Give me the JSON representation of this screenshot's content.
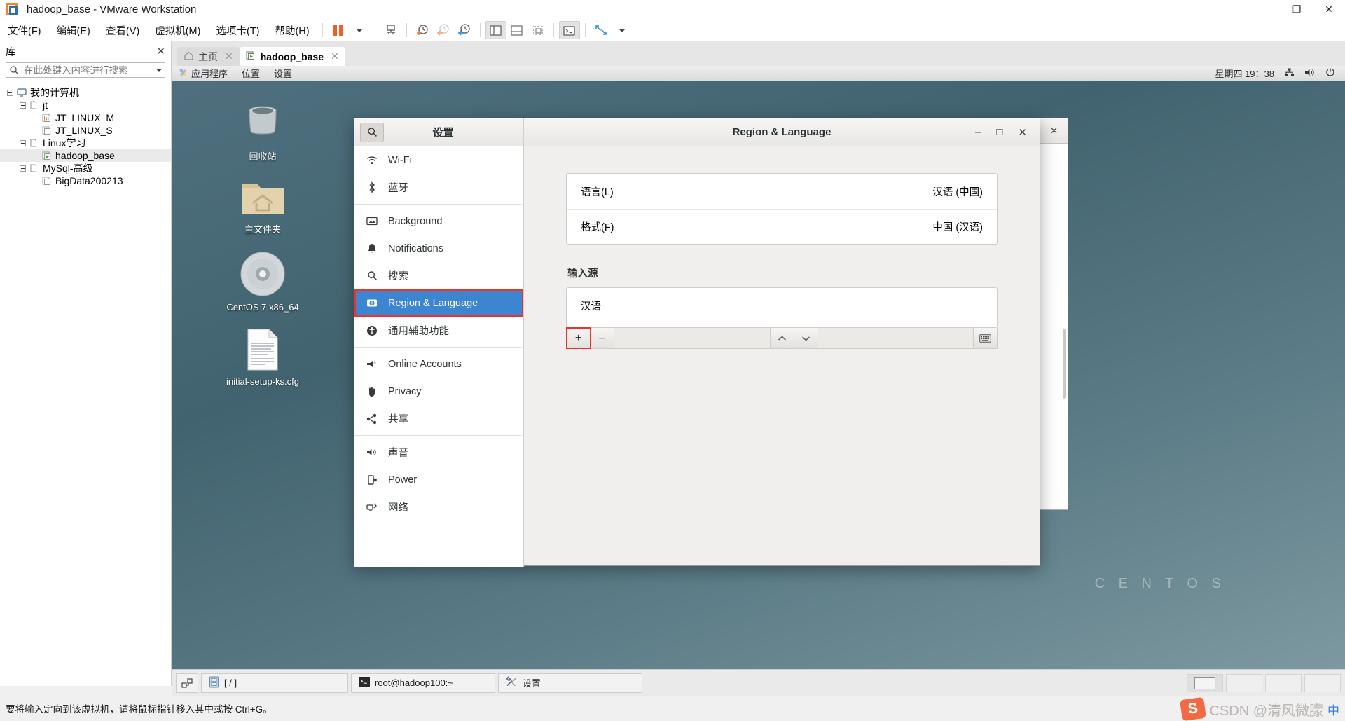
{
  "window": {
    "title": "hadoop_base - VMware Workstation",
    "minimize": "—",
    "maximize": "❐",
    "close": "✕"
  },
  "menubar": {
    "items": [
      {
        "label": "文件(F)",
        "key": "F"
      },
      {
        "label": "编辑(E)",
        "key": "E"
      },
      {
        "label": "查看(V)",
        "key": "V"
      },
      {
        "label": "虚拟机(M)",
        "key": "M"
      },
      {
        "label": "选项卡(T)",
        "key": "T"
      },
      {
        "label": "帮助(H)",
        "key": "H"
      }
    ],
    "icons": [
      "pause-icon",
      "dropdown-caret-icon",
      "send-ctrl-alt-del-icon",
      "snapshot-take-icon",
      "snapshot-revert-icon",
      "snapshot-manager-icon",
      "show-library-icon",
      "show-thumbnails-icon",
      "console-view-icon",
      "terminal-icon",
      "fullscreen-icon",
      "unity-caret-icon"
    ]
  },
  "library": {
    "title": "库",
    "close_label": "✕",
    "search_placeholder": "在此处键入内容进行搜索",
    "search_value": "",
    "tree": [
      {
        "label": "我的计算机",
        "depth": 0,
        "icon": "computer-icon",
        "expander": "minus",
        "selected": false
      },
      {
        "label": "jt",
        "depth": 1,
        "icon": "folder-icon",
        "expander": "minus",
        "selected": false
      },
      {
        "label": "JT_LINUX_M",
        "depth": 2,
        "icon": "vm-suspended-icon",
        "expander": "none",
        "selected": false
      },
      {
        "label": "JT_LINUX_S",
        "depth": 2,
        "icon": "vm-off-icon",
        "expander": "none",
        "selected": false
      },
      {
        "label": "Linux学习",
        "depth": 1,
        "icon": "folder-icon",
        "expander": "minus",
        "selected": false
      },
      {
        "label": "hadoop_base",
        "depth": 2,
        "icon": "vm-running-icon",
        "expander": "none",
        "selected": true
      },
      {
        "label": "MySql-高级",
        "depth": 1,
        "icon": "folder-icon",
        "expander": "minus",
        "selected": false
      },
      {
        "label": "BigData200213",
        "depth": 2,
        "icon": "vm-off-icon",
        "expander": "none",
        "selected": false
      }
    ]
  },
  "tabs": [
    {
      "label": "主页",
      "icon": "home-icon",
      "active": false,
      "close": "✕"
    },
    {
      "label": "hadoop_base",
      "icon": "vm-running-icon",
      "active": true,
      "close": "✕"
    }
  ],
  "guest": {
    "panel": {
      "menus": [
        "应用程序",
        "位置",
        "设置"
      ],
      "activities_icon": "gnome-foot-icon",
      "clock": "星期四 19：38",
      "tray_icons": [
        "network-icon",
        "volume-icon",
        "power-icon"
      ]
    },
    "desktop_icons": [
      {
        "label": "回收站",
        "icon": "trash-icon"
      },
      {
        "label": "主文件夹",
        "icon": "home-folder-icon"
      },
      {
        "label": "CentOS 7 x86_64",
        "icon": "cd-icon"
      },
      {
        "label": "initial-setup-ks.cfg",
        "icon": "text-file-icon"
      }
    ],
    "watermark": "C E N T O S"
  },
  "settings": {
    "search_icon": "search-icon",
    "sidebar_title": "设置",
    "content_title": "Region & Language",
    "window_controls": {
      "minimize": "–",
      "maximize": "□",
      "close": "✕"
    },
    "sidebar": [
      {
        "label": "Wi-Fi",
        "icon": "wifi-icon",
        "selected": false,
        "sep_after": false
      },
      {
        "label": "蓝牙",
        "icon": "bluetooth-icon",
        "selected": false,
        "sep_after": true
      },
      {
        "label": "Background",
        "icon": "background-icon",
        "selected": false,
        "sep_after": false
      },
      {
        "label": "Notifications",
        "icon": "bell-icon",
        "selected": false,
        "sep_after": false
      },
      {
        "label": "搜索",
        "icon": "search-icon",
        "selected": false,
        "sep_after": false
      },
      {
        "label": "Region & Language",
        "icon": "region-language-icon",
        "selected": true,
        "sep_after": false
      },
      {
        "label": "通用辅助功能",
        "icon": "accessibility-icon",
        "selected": false,
        "sep_after": true
      },
      {
        "label": "Online Accounts",
        "icon": "online-accounts-icon",
        "selected": false,
        "sep_after": false
      },
      {
        "label": "Privacy",
        "icon": "privacy-hand-icon",
        "selected": false,
        "sep_after": false
      },
      {
        "label": "共享",
        "icon": "sharing-icon",
        "selected": false,
        "sep_after": true
      },
      {
        "label": "声音",
        "icon": "sound-icon",
        "selected": false,
        "sep_after": false
      },
      {
        "label": "Power",
        "icon": "power-battery-icon",
        "selected": false,
        "sep_after": false
      },
      {
        "label": "网络",
        "icon": "network-icon",
        "selected": false,
        "sep_after": false
      }
    ],
    "rows": [
      {
        "label": "语言(L)",
        "value": "汉语 (中国)"
      },
      {
        "label": "格式(F)",
        "value": "中国 (汉语)"
      }
    ],
    "input_sources": {
      "section_title": "输入源",
      "items": [
        "汉语"
      ],
      "buttons": {
        "add": "+",
        "remove": "–",
        "move_up": "⌃",
        "move_down": "⌄",
        "keyboard": "keyboard-icon"
      },
      "add_highlighted": true
    }
  },
  "bottombar": {
    "buttons": [
      {
        "label": "",
        "icon": "devices-icon",
        "kind": "square"
      },
      {
        "label": "[ / ]",
        "icon": "drive-icon",
        "kind": "wide"
      },
      {
        "label": "root@hadoop100:~",
        "icon": "terminal-icon",
        "kind": "wide"
      },
      {
        "label": "设置",
        "icon": "settings-tools-icon",
        "kind": "wide"
      }
    ]
  },
  "statusbar": {
    "text": "要将输入定向到该虚拟机，请将鼠标指针移入其中或按 Ctrl+G。"
  },
  "watermark": {
    "logo": "S",
    "text": "CSDN @清风微朦",
    "ime": "中"
  },
  "colors": {
    "accent": "#3c85d0",
    "highlight_box": "#e8342a",
    "vmware_orange": "#f58220",
    "vmware_blue": "#2a6fb5"
  }
}
